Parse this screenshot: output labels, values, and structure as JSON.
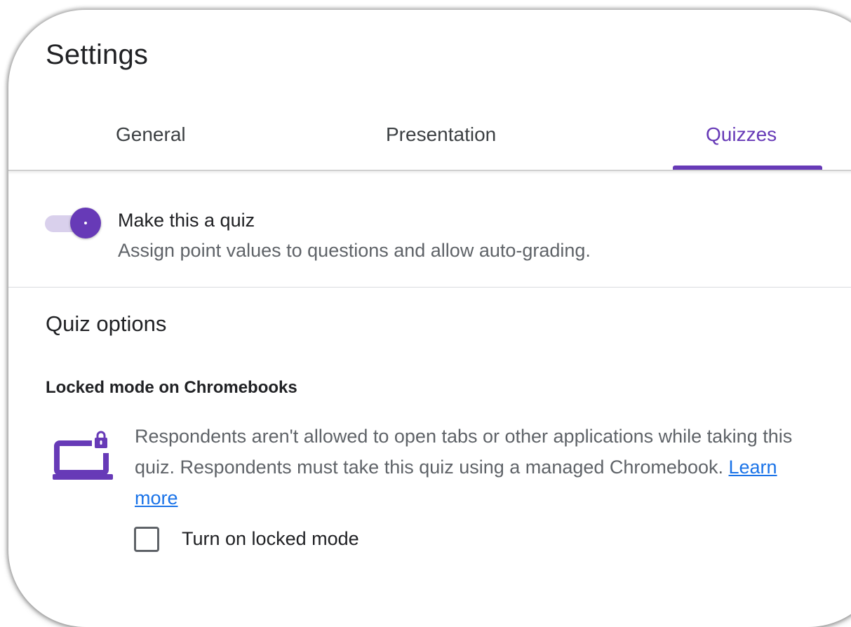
{
  "header": {
    "title": "Settings"
  },
  "tabs": [
    {
      "label": "General",
      "selected": false
    },
    {
      "label": "Presentation",
      "selected": false
    },
    {
      "label": "Quizzes",
      "selected": true
    }
  ],
  "quiz_toggle": {
    "label": "Make this a quiz",
    "description": "Assign point values to questions and allow auto-grading.",
    "on": true
  },
  "quiz_options": {
    "heading": "Quiz options",
    "locked_mode": {
      "heading": "Locked mode on Chromebooks",
      "description": "Respondents aren't allowed to open tabs or other applications while taking this quiz. Respondents must take this quiz using a managed Chromebook.",
      "learn_more": "Learn more",
      "icon": "locked-laptop-icon",
      "checkbox_label": "Turn on locked mode",
      "checked": false
    }
  },
  "colors": {
    "accent": "#673ab7",
    "toggle_track": "#d9d0ec",
    "link": "#1a73e8",
    "secondary_text": "#5f6368",
    "primary_text": "#202124"
  }
}
